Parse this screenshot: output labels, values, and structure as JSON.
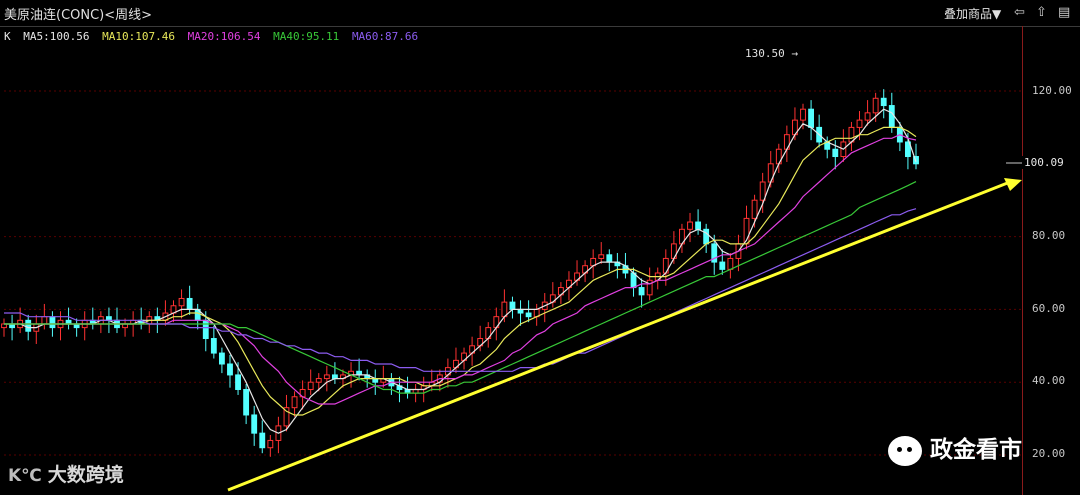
{
  "header": {
    "title": "美原油连(CONC)<周线>",
    "overlay_label": "叠加商品▼",
    "icons": [
      "arrow-left-icon",
      "arrow-up-icon",
      "arrow-right-icon",
      "layout-icon"
    ]
  },
  "ma_legend": {
    "k_label": "K",
    "items": [
      {
        "text": "MA5:100.56",
        "color": "#e6e6e6"
      },
      {
        "text": "MA10:107.46",
        "color": "#e8e85a"
      },
      {
        "text": "MA20:106.54",
        "color": "#e040e0"
      },
      {
        "text": "MA40:95.11",
        "color": "#38c838"
      },
      {
        "text": "MA60:87.66",
        "color": "#8c5cf0"
      }
    ]
  },
  "annotations": {
    "peak_label": "130.50",
    "last_price_label": "100.09"
  },
  "watermarks": {
    "left": "大数跨境",
    "right": "政金看市"
  },
  "chart_data": {
    "type": "line",
    "title": "美原油连(CONC)<周线>",
    "ylim": [
      20,
      135
    ],
    "yticks": [
      {
        "value": 120,
        "label": "120.00"
      },
      {
        "value": 100,
        "label": "100.09"
      },
      {
        "value": 80,
        "label": "80.00"
      },
      {
        "value": 60,
        "label": "60.00"
      },
      {
        "value": 40,
        "label": "40.00"
      },
      {
        "value": 20,
        "label": "20.00"
      }
    ],
    "grid": true,
    "colors": {
      "up": "#ff3232",
      "down": "#54ffff",
      "trendline": "#ffff30"
    },
    "candles_close": [
      56,
      55,
      57,
      54,
      56,
      58,
      55,
      57,
      56,
      55,
      57,
      56,
      58,
      57,
      55,
      56,
      57,
      56,
      58,
      57,
      59,
      61,
      63,
      60,
      57,
      52,
      48,
      45,
      42,
      38,
      31,
      26,
      22,
      24,
      28,
      33,
      36,
      38,
      40,
      41,
      42,
      41,
      42,
      43,
      42,
      41,
      40,
      41,
      39,
      38,
      37,
      38,
      39,
      40,
      42,
      44,
      46,
      48,
      50,
      52,
      55,
      58,
      62,
      60,
      59,
      58,
      60,
      62,
      64,
      66,
      68,
      70,
      72,
      74,
      75,
      73,
      72,
      70,
      66,
      64,
      68,
      70,
      74,
      78,
      82,
      84,
      82,
      78,
      73,
      71,
      74,
      78,
      85,
      90,
      95,
      100,
      104,
      108,
      112,
      115,
      110,
      106,
      104,
      102,
      106,
      110,
      112,
      114,
      118,
      116,
      110,
      106,
      102,
      100
    ],
    "series": [
      {
        "name": "MA5",
        "values": [
          56,
          56,
          56,
          55,
          55,
          56,
          56,
          56,
          56,
          56,
          56,
          56,
          57,
          57,
          56,
          56,
          56,
          57,
          57,
          57,
          58,
          59,
          60,
          60,
          60,
          58,
          56,
          52,
          48,
          44,
          40,
          35,
          30,
          27,
          26,
          27,
          30,
          33,
          36,
          38,
          40,
          41,
          41,
          42,
          42,
          42,
          41,
          41,
          40,
          39,
          38,
          38,
          38,
          39,
          40,
          42,
          44,
          46,
          48,
          50,
          52,
          55,
          58,
          60,
          60,
          60,
          60,
          61,
          62,
          64,
          66,
          68,
          70,
          72,
          73,
          73,
          73,
          72,
          70,
          68,
          67,
          68,
          70,
          74,
          78,
          81,
          82,
          81,
          79,
          76,
          75,
          76,
          79,
          84,
          89,
          95,
          100,
          104,
          108,
          111,
          110,
          108,
          106,
          105,
          104,
          106,
          108,
          111,
          113,
          115,
          114,
          111,
          107,
          100.56
        ]
      },
      {
        "name": "MA10",
        "values": [
          56,
          56,
          56,
          56,
          56,
          56,
          56,
          56,
          56,
          56,
          56,
          56,
          56,
          56,
          56,
          56,
          56,
          56,
          57,
          57,
          57,
          58,
          58,
          59,
          59,
          58,
          57,
          56,
          54,
          51,
          47,
          43,
          39,
          36,
          34,
          32,
          31,
          31,
          32,
          33,
          35,
          37,
          39,
          40,
          41,
          41,
          41,
          41,
          41,
          41,
          40,
          40,
          39,
          39,
          39,
          40,
          41,
          42,
          44,
          45,
          47,
          49,
          52,
          54,
          56,
          57,
          58,
          59,
          60,
          61,
          62,
          64,
          66,
          68,
          69,
          70,
          71,
          71,
          71,
          70,
          69,
          69,
          69,
          70,
          72,
          74,
          76,
          78,
          79,
          79,
          78,
          78,
          78,
          80,
          83,
          86,
          89,
          93,
          97,
          101,
          103,
          105,
          106,
          107,
          107,
          107,
          108,
          108,
          109,
          110,
          110,
          110,
          109,
          107.46
        ]
      },
      {
        "name": "MA20",
        "values": [
          56,
          56,
          56,
          56,
          56,
          56,
          56,
          56,
          56,
          56,
          56,
          56,
          56,
          56,
          56,
          56,
          56,
          56,
          56,
          56,
          56,
          57,
          57,
          57,
          57,
          57,
          56,
          56,
          55,
          54,
          52,
          50,
          47,
          45,
          43,
          40,
          38,
          36,
          35,
          34,
          34,
          34,
          35,
          36,
          37,
          38,
          39,
          39,
          40,
          40,
          40,
          40,
          40,
          40,
          41,
          41,
          41,
          42,
          42,
          43,
          44,
          45,
          46,
          48,
          49,
          51,
          53,
          54,
          56,
          57,
          58,
          59,
          61,
          62,
          63,
          64,
          65,
          66,
          66,
          67,
          67,
          68,
          68,
          69,
          70,
          71,
          72,
          73,
          74,
          75,
          75,
          76,
          77,
          78,
          80,
          82,
          84,
          86,
          88,
          91,
          93,
          95,
          97,
          99,
          101,
          103,
          104,
          105,
          106,
          107,
          107,
          108,
          107,
          106.54
        ]
      },
      {
        "name": "MA40",
        "values": [
          56,
          56,
          56,
          56,
          56,
          56,
          56,
          56,
          56,
          56,
          56,
          56,
          56,
          56,
          56,
          56,
          56,
          56,
          56,
          56,
          56,
          56,
          56,
          56,
          56,
          56,
          56,
          56,
          56,
          55,
          55,
          54,
          53,
          52,
          51,
          50,
          49,
          48,
          47,
          46,
          45,
          44,
          43,
          42,
          41,
          40,
          39,
          38,
          38,
          37,
          37,
          37,
          37,
          38,
          38,
          39,
          39,
          40,
          40,
          41,
          42,
          43,
          44,
          45,
          46,
          47,
          48,
          49,
          50,
          51,
          52,
          53,
          54,
          55,
          56,
          57,
          58,
          59,
          60,
          61,
          62,
          63,
          64,
          65,
          66,
          67,
          68,
          69,
          69,
          70,
          71,
          72,
          73,
          74,
          75,
          76,
          77,
          78,
          79,
          80,
          81,
          82,
          83,
          84,
          85,
          86,
          88,
          89,
          90,
          91,
          92,
          93,
          94,
          95.11
        ]
      },
      {
        "name": "MA60",
        "values": [
          59,
          59,
          59,
          58,
          58,
          58,
          58,
          58,
          58,
          57,
          57,
          57,
          57,
          57,
          57,
          57,
          57,
          57,
          56,
          56,
          56,
          56,
          56,
          55,
          55,
          55,
          55,
          54,
          54,
          53,
          53,
          52,
          52,
          51,
          51,
          50,
          50,
          49,
          49,
          48,
          48,
          47,
          47,
          46,
          46,
          46,
          45,
          45,
          45,
          44,
          44,
          44,
          43,
          43,
          43,
          43,
          43,
          43,
          43,
          43,
          43,
          43,
          43,
          43,
          44,
          44,
          44,
          45,
          45,
          46,
          47,
          48,
          48,
          49,
          50,
          51,
          52,
          53,
          54,
          55,
          56,
          57,
          58,
          59,
          60,
          61,
          62,
          63,
          64,
          65,
          66,
          67,
          68,
          69,
          70,
          71,
          72,
          73,
          74,
          75,
          76,
          77,
          78,
          79,
          80,
          81,
          82,
          83,
          84,
          85,
          86,
          86,
          87,
          87.66
        ]
      }
    ],
    "trendline": {
      "start": {
        "index": 32,
        "value": 20
      },
      "end": {
        "index": 140,
        "value": 95
      }
    }
  }
}
